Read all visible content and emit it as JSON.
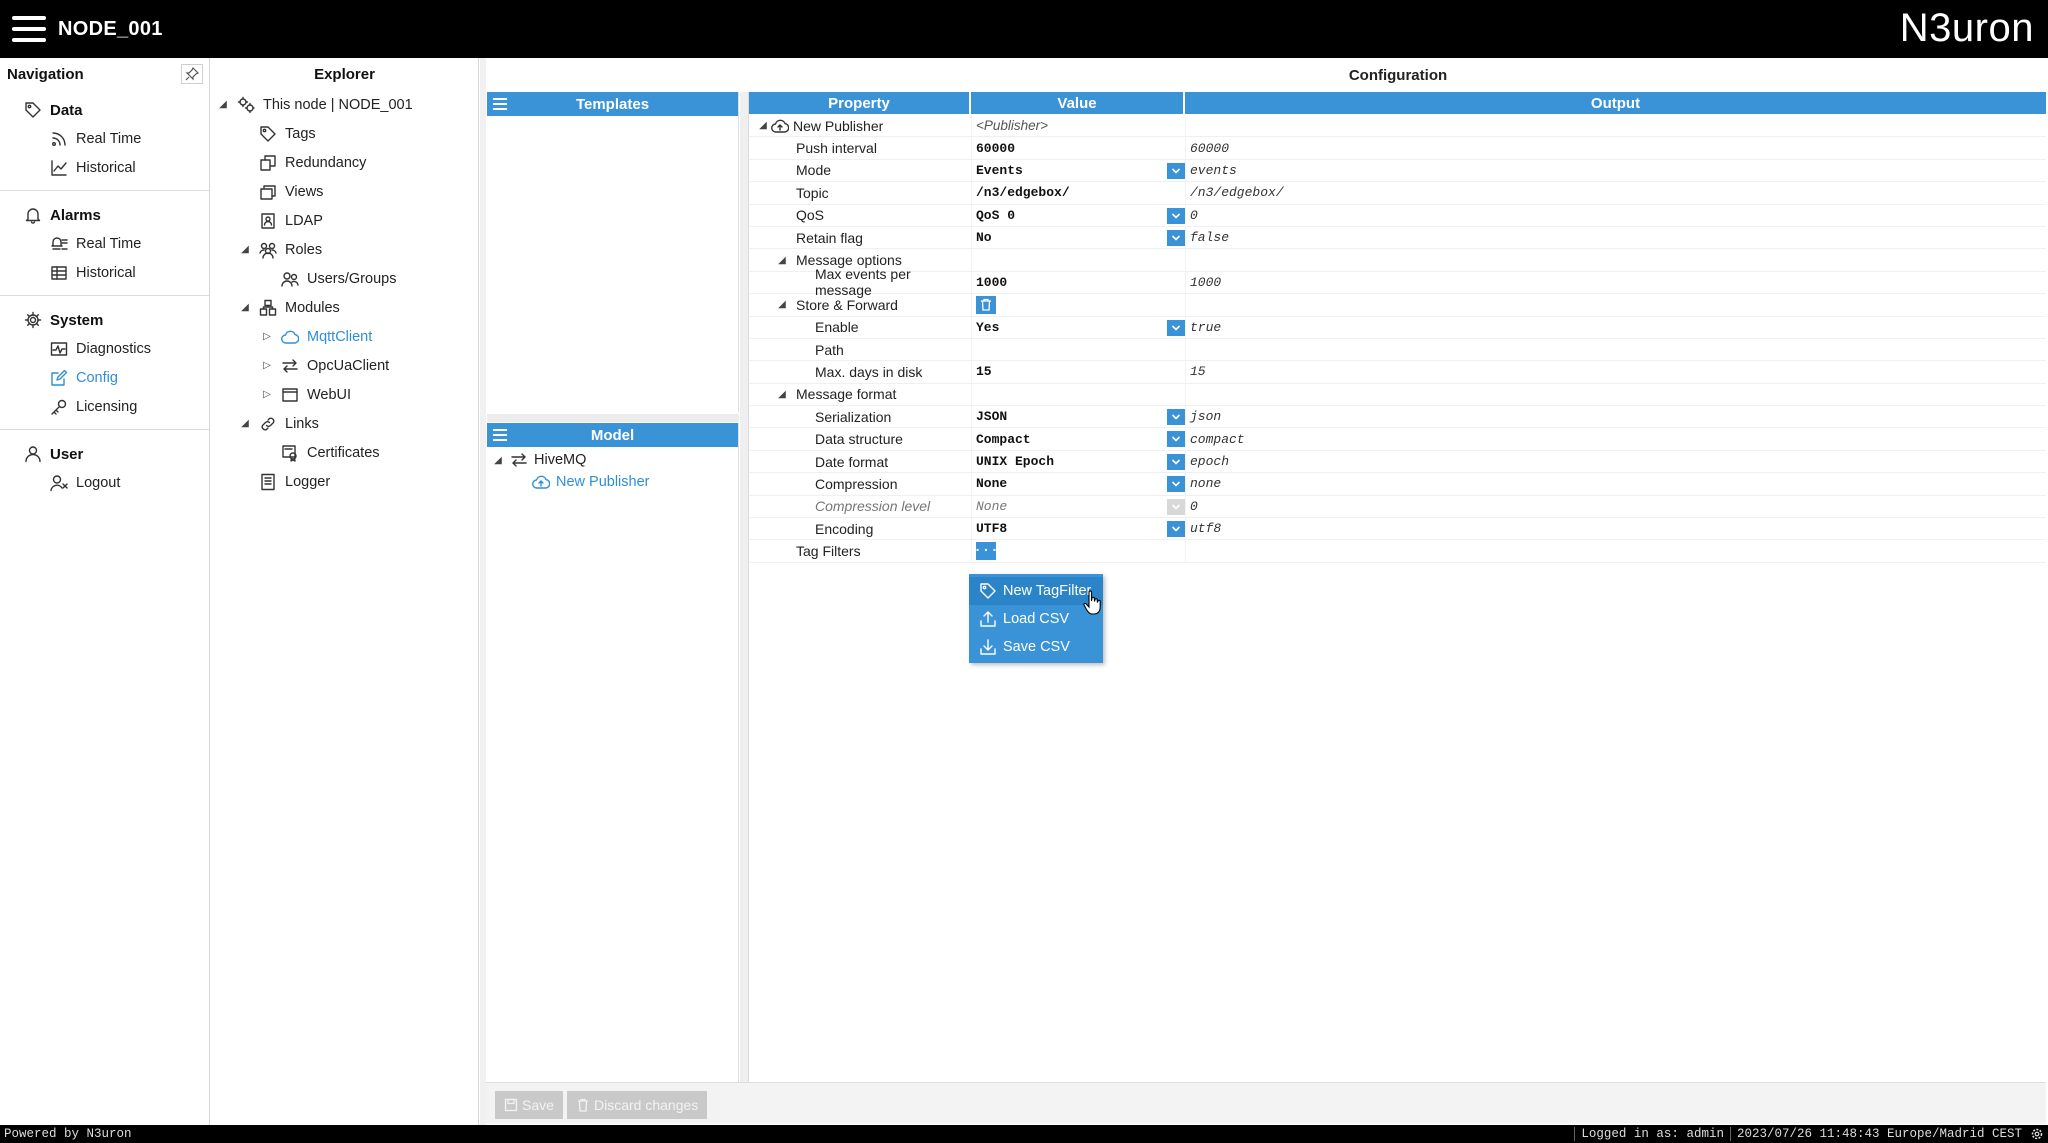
{
  "header": {
    "node_title": "NODE_001",
    "brand": "N3uron"
  },
  "navigation": {
    "title": "Navigation",
    "groups": [
      {
        "title": "Data",
        "icon": "tag-icon",
        "items": [
          {
            "label": "Real Time",
            "icon": "rss-icon"
          },
          {
            "label": "Historical",
            "icon": "line-chart-icon"
          }
        ]
      },
      {
        "title": "Alarms",
        "icon": "bell-icon",
        "items": [
          {
            "label": "Real Time",
            "icon": "alarm-list-icon"
          },
          {
            "label": "Historical",
            "icon": "table-icon"
          }
        ]
      },
      {
        "title": "System",
        "icon": "gear-icon",
        "items": [
          {
            "label": "Diagnostics",
            "icon": "pulse-icon"
          },
          {
            "label": "Config",
            "icon": "edit-icon",
            "active": true
          },
          {
            "label": "Licensing",
            "icon": "key-icon"
          }
        ]
      },
      {
        "title": "User",
        "icon": "user-icon",
        "items": [
          {
            "label": "Logout",
            "icon": "user-x-icon"
          }
        ]
      }
    ]
  },
  "explorer": {
    "title": "Explorer",
    "items": [
      {
        "label": "This node | NODE_001",
        "depth": 0,
        "toggle": "▲",
        "icon": "node-icon"
      },
      {
        "label": "Tags",
        "depth": 1,
        "toggle": "",
        "icon": "tag-icon"
      },
      {
        "label": "Redundancy",
        "depth": 1,
        "toggle": "",
        "icon": "redundancy-icon"
      },
      {
        "label": "Views",
        "depth": 1,
        "toggle": "",
        "icon": "views-icon"
      },
      {
        "label": "LDAP",
        "depth": 1,
        "toggle": "",
        "icon": "ldap-icon"
      },
      {
        "label": "Roles",
        "depth": 1,
        "toggle": "▲",
        "icon": "roles-icon"
      },
      {
        "label": "Users/Groups",
        "depth": 2,
        "toggle": "",
        "icon": "users-icon"
      },
      {
        "label": "Modules",
        "depth": 1,
        "toggle": "▲",
        "icon": "modules-icon"
      },
      {
        "label": "MqttClient",
        "depth": 2,
        "toggle": "▷",
        "icon": "cloud-icon",
        "active": true
      },
      {
        "label": "OpcUaClient",
        "depth": 2,
        "toggle": "▷",
        "icon": "arrows-icon"
      },
      {
        "label": "WebUI",
        "depth": 2,
        "toggle": "▷",
        "icon": "window-icon"
      },
      {
        "label": "Links",
        "depth": 1,
        "toggle": "▲",
        "icon": "link-icon"
      },
      {
        "label": "Certificates",
        "depth": 2,
        "toggle": "",
        "icon": "certificate-icon"
      },
      {
        "label": "Logger",
        "depth": 1,
        "toggle": "",
        "icon": "logger-icon"
      }
    ]
  },
  "templates": {
    "title": "Templates"
  },
  "model": {
    "title": "Model",
    "items": [
      {
        "label": "HiveMQ",
        "toggle": "▲",
        "icon": "arrows-icon",
        "depth": 0
      },
      {
        "label": "New Publisher",
        "toggle": "",
        "icon": "cloud-upload-icon",
        "depth": 1,
        "active": true
      }
    ]
  },
  "config": {
    "title": "Configuration",
    "headers": {
      "property": "Property",
      "value": "Value",
      "output": "Output"
    },
    "rows": [
      {
        "property": "New Publisher",
        "depth": 0,
        "toggle": "▲",
        "value": "<Publisher>",
        "output": "",
        "kind": "group"
      },
      {
        "property": "Push interval",
        "depth": 1,
        "value": "60000",
        "output": "60000"
      },
      {
        "property": "Mode",
        "depth": 1,
        "value": "Events",
        "output": "events",
        "dropdown": true
      },
      {
        "property": "Topic",
        "depth": 1,
        "value": "/n3/edgebox/",
        "output": "/n3/edgebox/"
      },
      {
        "property": "QoS",
        "depth": 1,
        "value": "QoS 0",
        "output": "0",
        "dropdown": true
      },
      {
        "property": "Retain flag",
        "depth": 1,
        "value": "No",
        "output": "false",
        "dropdown": true
      },
      {
        "property": "Message options",
        "depth": 1,
        "toggle": "▲",
        "value": "",
        "output": ""
      },
      {
        "property": "Max events per message",
        "depth": 2,
        "value": "1000",
        "output": "1000"
      },
      {
        "property": "Store & Forward",
        "depth": 1,
        "toggle": "▲",
        "value": "",
        "output": "",
        "delete": true
      },
      {
        "property": "Enable",
        "depth": 2,
        "value": "Yes",
        "output": "true",
        "dropdown": true
      },
      {
        "property": "Path",
        "depth": 2,
        "value": "",
        "output": ""
      },
      {
        "property": "Max. days in disk",
        "depth": 2,
        "value": "15",
        "output": "15"
      },
      {
        "property": "Message format",
        "depth": 1,
        "toggle": "▲",
        "value": "",
        "output": ""
      },
      {
        "property": "Serialization",
        "depth": 2,
        "value": "JSON",
        "output": "json",
        "dropdown": true
      },
      {
        "property": "Data structure",
        "depth": 2,
        "value": "Compact",
        "output": "compact",
        "dropdown": true
      },
      {
        "property": "Date format",
        "depth": 2,
        "value": "UNIX Epoch",
        "output": "epoch",
        "dropdown": true
      },
      {
        "property": "Compression",
        "depth": 2,
        "value": "None",
        "output": "none",
        "dropdown": true
      },
      {
        "property": "Compression level",
        "depth": 2,
        "value": "None",
        "output": "0",
        "dropdown": true,
        "disabled": true
      },
      {
        "property": "Encoding",
        "depth": 2,
        "value": "UTF8",
        "output": "utf8",
        "dropdown": true
      },
      {
        "property": "Tag Filters",
        "depth": 1,
        "value": "",
        "output": "",
        "more": true
      }
    ]
  },
  "popup_menu": [
    {
      "label": "New TagFilter",
      "icon": "tag-icon",
      "hover": true
    },
    {
      "label": "Load CSV",
      "icon": "upload-icon"
    },
    {
      "label": "Save CSV",
      "icon": "download-icon"
    }
  ],
  "actions": {
    "save": "Save",
    "discard": "Discard changes"
  },
  "status": {
    "powered": "Powered by N3uron",
    "logged_in": "Logged in as: admin",
    "datetime": "2023/07/26 11:48:43 Europe/Madrid CEST"
  },
  "colors": {
    "accent": "#3a93d6",
    "active_text": "#2f8ed9",
    "topbar": "#000000"
  }
}
